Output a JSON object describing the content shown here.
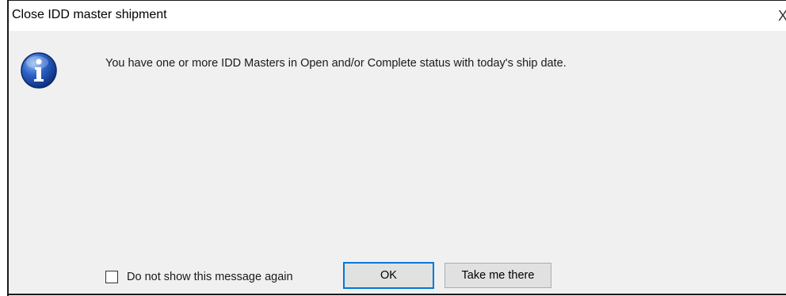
{
  "dialog": {
    "title": "Close IDD master shipment",
    "close_glyph": "X",
    "icon": "info-icon",
    "message": "You have one or more IDD Masters in Open and/or Complete status with today's ship date.",
    "checkbox": {
      "label": "Do not show this message again",
      "checked": false
    },
    "buttons": {
      "ok": "OK",
      "take_me_there": "Take me there"
    }
  },
  "colors": {
    "dialog_bg": "#f0f0f0",
    "titlebar_bg": "#ffffff",
    "default_button_border": "#0078d7",
    "info_icon_blue": "#1f57b8"
  }
}
